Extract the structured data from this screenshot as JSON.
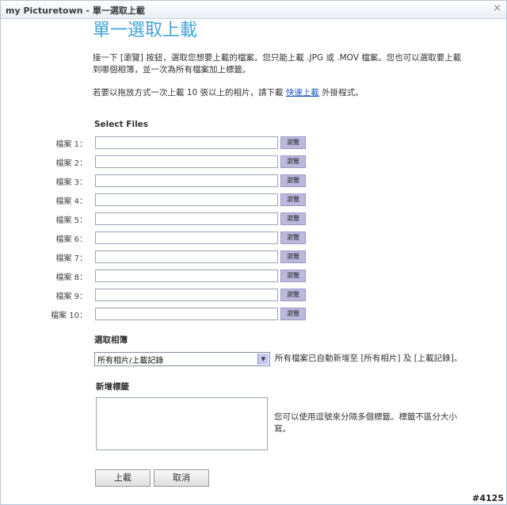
{
  "window": {
    "title": "my Picturetown - 單一選取上載",
    "close_glyph": "×"
  },
  "page": {
    "heading": "單一選取上載",
    "instructions": "接一下 [瀏覽] 按鈕，選取您想要上載的檔案。您只能上載 .JPG 或 .MOV 檔案。您也可以選取要上載到哪個相簿，並一次為所有檔案加上標籤。",
    "plugin_text_before": "若要以拖放方式一次上載 10 張以上的相片，請下載",
    "plugin_link": "快速上載",
    "plugin_text_after": "外掛程式。"
  },
  "files": {
    "section_title": "Select Files",
    "browse_label": "瀏覽",
    "rows": [
      {
        "label": "檔案 1：",
        "value": ""
      },
      {
        "label": "檔案 2：",
        "value": ""
      },
      {
        "label": "檔案 3：",
        "value": ""
      },
      {
        "label": "檔案 4：",
        "value": ""
      },
      {
        "label": "檔案 5：",
        "value": ""
      },
      {
        "label": "檔案 6：",
        "value": ""
      },
      {
        "label": "檔案 7：",
        "value": ""
      },
      {
        "label": "檔案 8：",
        "value": ""
      },
      {
        "label": "檔案 9：",
        "value": ""
      },
      {
        "label": "檔案 10：",
        "value": ""
      }
    ]
  },
  "album": {
    "section_title": "選取相簿",
    "selected": "所有相片/上載記錄",
    "note": "所有檔案已自動新增至 [所有相片] 及 [上載記錄]。"
  },
  "tags": {
    "section_title": "新增標籤",
    "value": "",
    "note": "您可以使用逗號來分隔多個標籤。標籤不區分大小寫。"
  },
  "buttons": {
    "upload": "上載",
    "cancel": "取消"
  },
  "watermark": "#4125"
}
